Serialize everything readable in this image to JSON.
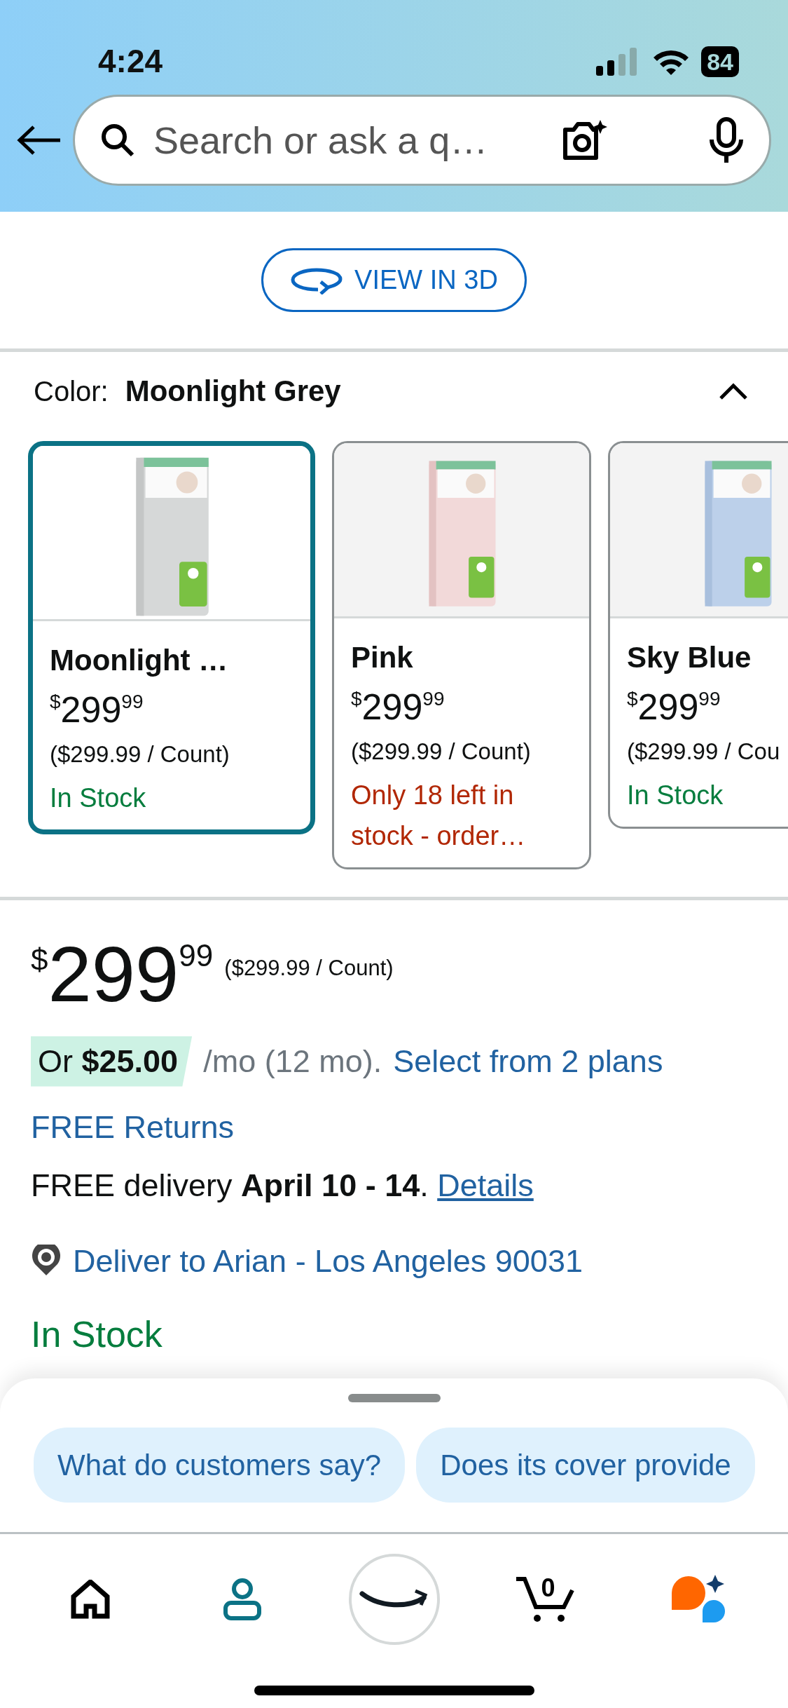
{
  "status_bar": {
    "time": "4:24",
    "battery": "84"
  },
  "search": {
    "placeholder": "Search or ask a q…"
  },
  "view_3d": {
    "label": "VIEW IN 3D"
  },
  "color_selector": {
    "label": "Color:",
    "value": "Moonlight Grey",
    "expanded": true,
    "options": [
      {
        "name": "Moonlight …",
        "currency": "$",
        "price_whole": "299",
        "price_fraction": "99",
        "unit_price": "($299.99 / Count)",
        "stock": {
          "text": "In Stock",
          "color": "#067d3e"
        },
        "selected": true
      },
      {
        "name": "Pink",
        "currency": "$",
        "price_whole": "299",
        "price_fraction": "99",
        "unit_price": "($299.99 / Count)",
        "stock": {
          "text": "Only 18 left in stock - order…",
          "color": "#b12704"
        },
        "selected": false
      },
      {
        "name": "Sky Blue",
        "currency": "$",
        "price_whole": "299",
        "price_fraction": "99",
        "unit_price": "($299.99 / Cou",
        "stock": {
          "text": "In Stock",
          "color": "#067d3e"
        },
        "selected": false
      }
    ]
  },
  "price": {
    "currency": "$",
    "whole": "299",
    "fraction": "99",
    "unit_price": "($299.99 / Count)"
  },
  "installment": {
    "offer": "Or **$25.00**",
    "terms": "/mo (12 mo).",
    "link": "Select from 2 plans"
  },
  "returns": "FREE Returns",
  "delivery": {
    "text": "FREE delivery **April 10 - 14**.",
    "link": "Details"
  },
  "deliver_to": "Deliver to Arian - Los Angeles 90031",
  "availability": "In Stock",
  "suggestions": [
    "What do customers say?",
    "Does its cover provide"
  ],
  "tab_bar": [
    {
      "kind": "home",
      "selected": false
    },
    {
      "kind": "profile",
      "selected": true
    },
    {
      "kind": "logo",
      "selected": false
    },
    {
      "kind": "cart",
      "count": "0",
      "selected": false
    },
    {
      "kind": "assistant",
      "selected": false
    }
  ]
}
